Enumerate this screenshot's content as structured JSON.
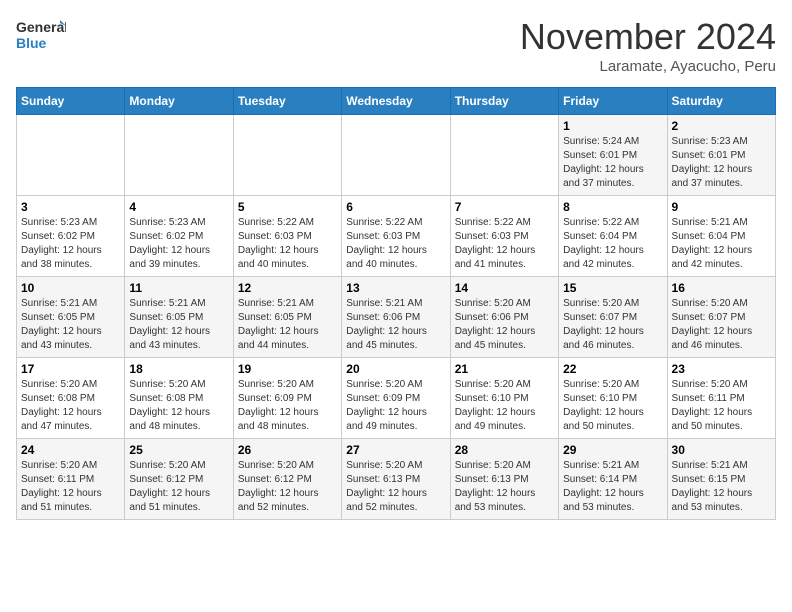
{
  "header": {
    "logo_line1": "General",
    "logo_line2": "Blue",
    "month": "November 2024",
    "location": "Laramate, Ayacucho, Peru"
  },
  "weekdays": [
    "Sunday",
    "Monday",
    "Tuesday",
    "Wednesday",
    "Thursday",
    "Friday",
    "Saturday"
  ],
  "weeks": [
    [
      {
        "day": "",
        "info": ""
      },
      {
        "day": "",
        "info": ""
      },
      {
        "day": "",
        "info": ""
      },
      {
        "day": "",
        "info": ""
      },
      {
        "day": "",
        "info": ""
      },
      {
        "day": "1",
        "info": "Sunrise: 5:24 AM\nSunset: 6:01 PM\nDaylight: 12 hours\nand 37 minutes."
      },
      {
        "day": "2",
        "info": "Sunrise: 5:23 AM\nSunset: 6:01 PM\nDaylight: 12 hours\nand 37 minutes."
      }
    ],
    [
      {
        "day": "3",
        "info": "Sunrise: 5:23 AM\nSunset: 6:02 PM\nDaylight: 12 hours\nand 38 minutes."
      },
      {
        "day": "4",
        "info": "Sunrise: 5:23 AM\nSunset: 6:02 PM\nDaylight: 12 hours\nand 39 minutes."
      },
      {
        "day": "5",
        "info": "Sunrise: 5:22 AM\nSunset: 6:03 PM\nDaylight: 12 hours\nand 40 minutes."
      },
      {
        "day": "6",
        "info": "Sunrise: 5:22 AM\nSunset: 6:03 PM\nDaylight: 12 hours\nand 40 minutes."
      },
      {
        "day": "7",
        "info": "Sunrise: 5:22 AM\nSunset: 6:03 PM\nDaylight: 12 hours\nand 41 minutes."
      },
      {
        "day": "8",
        "info": "Sunrise: 5:22 AM\nSunset: 6:04 PM\nDaylight: 12 hours\nand 42 minutes."
      },
      {
        "day": "9",
        "info": "Sunrise: 5:21 AM\nSunset: 6:04 PM\nDaylight: 12 hours\nand 42 minutes."
      }
    ],
    [
      {
        "day": "10",
        "info": "Sunrise: 5:21 AM\nSunset: 6:05 PM\nDaylight: 12 hours\nand 43 minutes."
      },
      {
        "day": "11",
        "info": "Sunrise: 5:21 AM\nSunset: 6:05 PM\nDaylight: 12 hours\nand 43 minutes."
      },
      {
        "day": "12",
        "info": "Sunrise: 5:21 AM\nSunset: 6:05 PM\nDaylight: 12 hours\nand 44 minutes."
      },
      {
        "day": "13",
        "info": "Sunrise: 5:21 AM\nSunset: 6:06 PM\nDaylight: 12 hours\nand 45 minutes."
      },
      {
        "day": "14",
        "info": "Sunrise: 5:20 AM\nSunset: 6:06 PM\nDaylight: 12 hours\nand 45 minutes."
      },
      {
        "day": "15",
        "info": "Sunrise: 5:20 AM\nSunset: 6:07 PM\nDaylight: 12 hours\nand 46 minutes."
      },
      {
        "day": "16",
        "info": "Sunrise: 5:20 AM\nSunset: 6:07 PM\nDaylight: 12 hours\nand 46 minutes."
      }
    ],
    [
      {
        "day": "17",
        "info": "Sunrise: 5:20 AM\nSunset: 6:08 PM\nDaylight: 12 hours\nand 47 minutes."
      },
      {
        "day": "18",
        "info": "Sunrise: 5:20 AM\nSunset: 6:08 PM\nDaylight: 12 hours\nand 48 minutes."
      },
      {
        "day": "19",
        "info": "Sunrise: 5:20 AM\nSunset: 6:09 PM\nDaylight: 12 hours\nand 48 minutes."
      },
      {
        "day": "20",
        "info": "Sunrise: 5:20 AM\nSunset: 6:09 PM\nDaylight: 12 hours\nand 49 minutes."
      },
      {
        "day": "21",
        "info": "Sunrise: 5:20 AM\nSunset: 6:10 PM\nDaylight: 12 hours\nand 49 minutes."
      },
      {
        "day": "22",
        "info": "Sunrise: 5:20 AM\nSunset: 6:10 PM\nDaylight: 12 hours\nand 50 minutes."
      },
      {
        "day": "23",
        "info": "Sunrise: 5:20 AM\nSunset: 6:11 PM\nDaylight: 12 hours\nand 50 minutes."
      }
    ],
    [
      {
        "day": "24",
        "info": "Sunrise: 5:20 AM\nSunset: 6:11 PM\nDaylight: 12 hours\nand 51 minutes."
      },
      {
        "day": "25",
        "info": "Sunrise: 5:20 AM\nSunset: 6:12 PM\nDaylight: 12 hours\nand 51 minutes."
      },
      {
        "day": "26",
        "info": "Sunrise: 5:20 AM\nSunset: 6:12 PM\nDaylight: 12 hours\nand 52 minutes."
      },
      {
        "day": "27",
        "info": "Sunrise: 5:20 AM\nSunset: 6:13 PM\nDaylight: 12 hours\nand 52 minutes."
      },
      {
        "day": "28",
        "info": "Sunrise: 5:20 AM\nSunset: 6:13 PM\nDaylight: 12 hours\nand 53 minutes."
      },
      {
        "day": "29",
        "info": "Sunrise: 5:21 AM\nSunset: 6:14 PM\nDaylight: 12 hours\nand 53 minutes."
      },
      {
        "day": "30",
        "info": "Sunrise: 5:21 AM\nSunset: 6:15 PM\nDaylight: 12 hours\nand 53 minutes."
      }
    ]
  ]
}
